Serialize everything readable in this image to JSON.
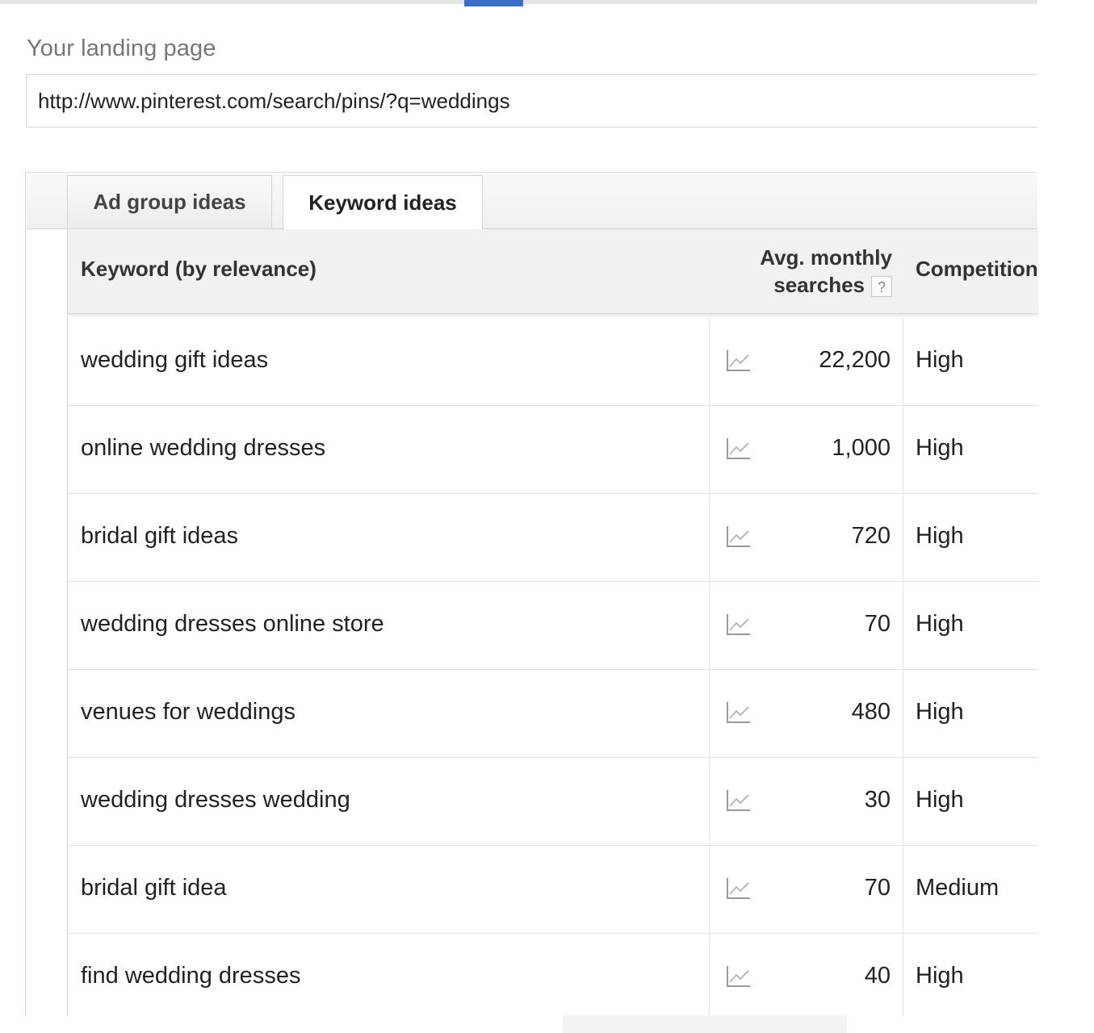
{
  "landing": {
    "label": "Your landing page",
    "url": "http://www.pinterest.com/search/pins/?q=weddings"
  },
  "tabs": [
    {
      "label": "Ad group ideas",
      "active": false
    },
    {
      "label": "Keyword ideas",
      "active": true
    }
  ],
  "table": {
    "headers": {
      "keyword": "Keyword (by relevance)",
      "avg_line1": "Avg. monthly",
      "avg_line2": "searches",
      "help": "?",
      "competition": "Competition"
    },
    "rows": [
      {
        "keyword": "wedding gift ideas",
        "searches": "22,200",
        "competition": "High"
      },
      {
        "keyword": "online wedding dresses",
        "searches": "1,000",
        "competition": "High"
      },
      {
        "keyword": "bridal gift ideas",
        "searches": "720",
        "competition": "High"
      },
      {
        "keyword": "wedding dresses online store",
        "searches": "70",
        "competition": "High"
      },
      {
        "keyword": "venues for weddings",
        "searches": "480",
        "competition": "High"
      },
      {
        "keyword": "wedding dresses wedding",
        "searches": "30",
        "competition": "High"
      },
      {
        "keyword": "bridal gift idea",
        "searches": "70",
        "competition": "Medium"
      },
      {
        "keyword": "find wedding dresses",
        "searches": "40",
        "competition": "High"
      }
    ]
  },
  "icons": {
    "trend": "trend-chart-icon",
    "help": "help-icon"
  },
  "colors": {
    "accent": "#3b6fc6",
    "header_bg": "#f1f1f1",
    "border": "#d6d6d6"
  }
}
